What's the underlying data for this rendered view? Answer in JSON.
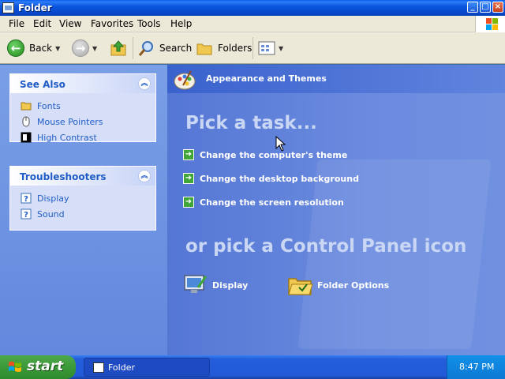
{
  "window": {
    "title": "Folder"
  },
  "menu": [
    "File",
    "Edit",
    "View",
    "Favorites",
    "Tools",
    "Help"
  ],
  "toolbar": {
    "back_label": "Back",
    "search_label": "Search",
    "folders_label": "Folders"
  },
  "see_also": {
    "title": "See Also",
    "items": [
      {
        "label": "Fonts",
        "icon": "folder-icon"
      },
      {
        "label": "Mouse Pointers",
        "icon": "mouse-icon"
      },
      {
        "label": "High Contrast",
        "icon": "contrast-icon"
      }
    ]
  },
  "troubleshooters": {
    "title": "Troubleshooters",
    "items": [
      {
        "label": "Display",
        "icon": "help-icon"
      },
      {
        "label": "Sound",
        "icon": "help-icon"
      }
    ]
  },
  "main": {
    "category_title": "Appearance and Themes",
    "pick_task": "Pick a task...",
    "tasks": [
      "Change the computer's theme",
      "Change the desktop background",
      "Change the screen resolution"
    ],
    "pick_icon": "or pick a Control Panel icon",
    "icons": [
      {
        "label": "Display",
        "icon": "display-icon"
      },
      {
        "label": "Folder Options",
        "icon": "folder-options-icon"
      }
    ]
  },
  "taskbar": {
    "start_label": "start",
    "window_button": "Folder",
    "clock": "8:47 PM"
  },
  "colors": {
    "title_bar": "#0a56e0",
    "left_pane": "#7a9fe6",
    "main_pane": "#6b8bdf",
    "task_arrow": "#3fa637",
    "start_button": "#3c9a39"
  }
}
